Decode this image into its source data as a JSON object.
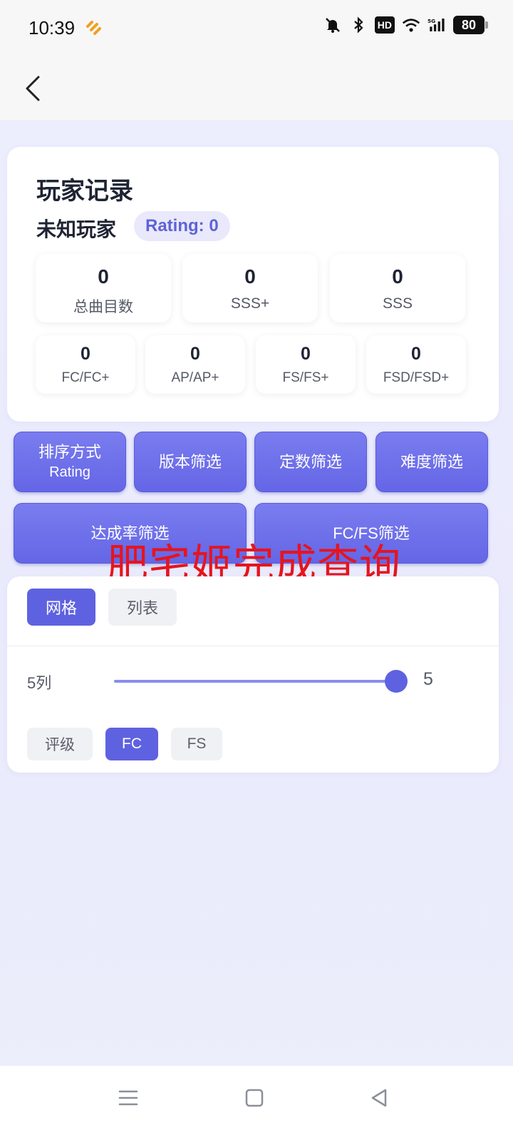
{
  "status_bar": {
    "time": "10:39",
    "hd": "HD",
    "battery": "80",
    "icons": [
      "bell-off-icon",
      "bluetooth-icon",
      "hd-icon",
      "wifi-icon",
      "signal-5g-icon",
      "battery-icon"
    ]
  },
  "app_bar": {
    "back_icon": "chevron-left-icon"
  },
  "record": {
    "title": "玩家记录",
    "player_name": "未知玩家",
    "rating_label": "Rating: 0",
    "stats_top": [
      {
        "value": "0",
        "label": "总曲目数"
      },
      {
        "value": "0",
        "label": "SSS+"
      },
      {
        "value": "0",
        "label": "SSS"
      }
    ],
    "stats_bottom": [
      {
        "value": "0",
        "label": "FC/FC+"
      },
      {
        "value": "0",
        "label": "AP/AP+"
      },
      {
        "value": "0",
        "label": "FS/FS+"
      },
      {
        "value": "0",
        "label": "FSD/FSD+"
      }
    ]
  },
  "filters": {
    "sort": {
      "line1": "排序方式",
      "line2": "Rating"
    },
    "version": "版本筛选",
    "constant": "定数筛选",
    "difficulty": "难度筛选",
    "achievement": "达成率筛选",
    "fcfs": "FC/FS筛选"
  },
  "watermark": "肥宅姬完成查询",
  "view": {
    "tabs": [
      {
        "label": "网格",
        "active": true
      },
      {
        "label": "列表",
        "active": false
      }
    ],
    "columns_label": "5列",
    "columns_value": "5",
    "columns_min": 1,
    "columns_max": 5,
    "chips": [
      {
        "label": "评级",
        "active": false
      },
      {
        "label": "FC",
        "active": true
      },
      {
        "label": "FS",
        "active": false
      }
    ]
  },
  "colors": {
    "accent": "#5f62e0",
    "background": "#edeefd",
    "watermark": "#e6141e"
  }
}
